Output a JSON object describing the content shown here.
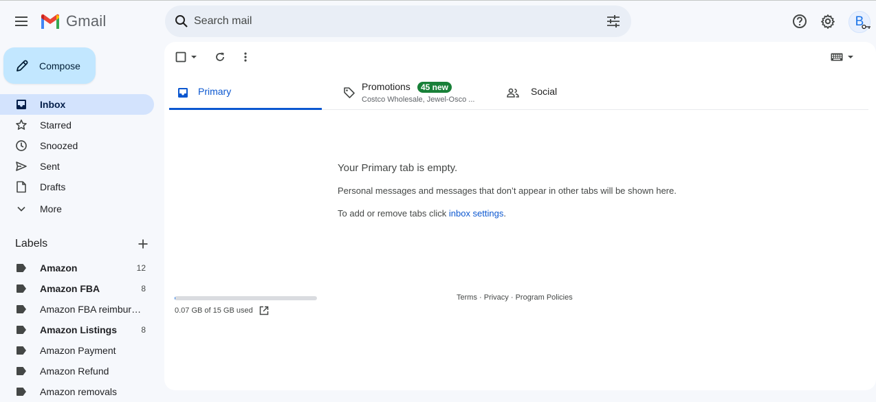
{
  "header": {
    "app_name": "Gmail",
    "search_placeholder": "Search mail",
    "avatar_initial": "B"
  },
  "compose": {
    "label": "Compose"
  },
  "nav": {
    "items": [
      {
        "label": "Inbox",
        "icon": "inbox-icon",
        "active": true
      },
      {
        "label": "Starred",
        "icon": "star-icon"
      },
      {
        "label": "Snoozed",
        "icon": "clock-icon"
      },
      {
        "label": "Sent",
        "icon": "send-icon"
      },
      {
        "label": "Drafts",
        "icon": "draft-icon"
      },
      {
        "label": "More",
        "icon": "chevron-down-icon"
      }
    ]
  },
  "labels": {
    "title": "Labels",
    "items": [
      {
        "name": "Amazon",
        "count": "12",
        "bold": true
      },
      {
        "name": "Amazon FBA",
        "count": "8",
        "bold": true
      },
      {
        "name": "Amazon FBA reimburse...",
        "count": "",
        "bold": false
      },
      {
        "name": "Amazon Listings",
        "count": "8",
        "bold": true
      },
      {
        "name": "Amazon Payment",
        "count": "",
        "bold": false
      },
      {
        "name": "Amazon Refund",
        "count": "",
        "bold": false
      },
      {
        "name": "Amazon removals",
        "count": "",
        "bold": false
      }
    ]
  },
  "tabs": {
    "primary": "Primary",
    "promotions": "Promotions",
    "promotions_badge": "45 new",
    "promotions_snippet": "Costco Wholesale, Jewel-Osco ...",
    "social": "Social"
  },
  "empty_state": {
    "title": "Your Primary tab is empty.",
    "description": "Personal messages and messages that don’t appear in other tabs will be shown here.",
    "settings_prefix": "To add or remove tabs click ",
    "settings_link": "inbox settings",
    "settings_suffix": "."
  },
  "storage": {
    "text": "0.07 GB of 15 GB used",
    "used_fraction": 0.005
  },
  "footer": {
    "terms": "Terms",
    "sep": " · ",
    "privacy": "Privacy",
    "policies": "Program Policies"
  },
  "colors": {
    "accent": "#0b57d0",
    "compose_bg": "#c2e7ff",
    "active_nav_bg": "#d3e3fd",
    "badge_green": "#188038"
  }
}
